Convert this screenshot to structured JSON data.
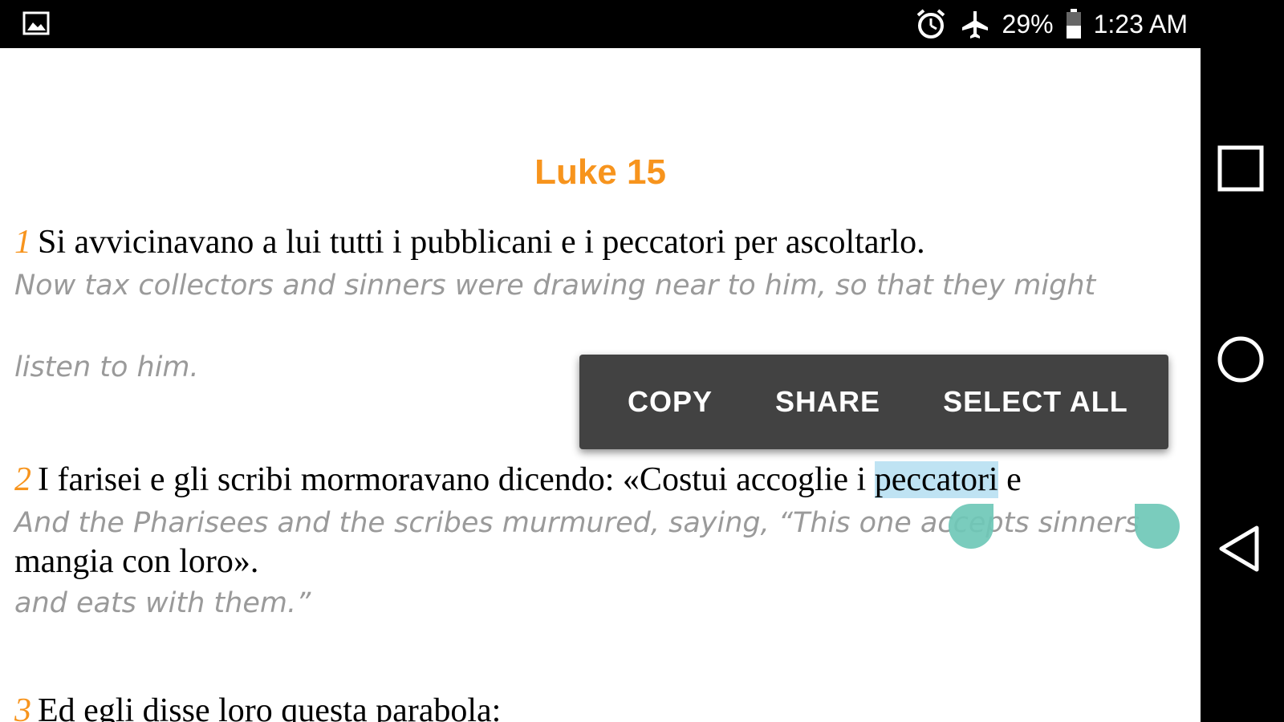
{
  "status_bar": {
    "left_icon": "image-icon",
    "icons": [
      "alarm-icon",
      "airplane-mode-icon",
      "battery-icon"
    ],
    "battery_percent": "29%",
    "time": "1:23 AM"
  },
  "chapter": {
    "title": "Luke 15"
  },
  "verses": [
    {
      "number": "1",
      "italian": "Si avvicinavano a lui tutti i pubblicani e i peccatori per ascoltarlo.",
      "english_line1": "Now tax collectors and sinners were drawing near to him, so that they might",
      "english_line2": "listen to him."
    },
    {
      "number": "2",
      "italian_before": "I farisei e gli scribi mormoravano dicendo: «Costui accoglie i ",
      "italian_selected": "peccatori",
      "italian_after": " e",
      "english_line1": "And the Pharisees and the scribes murmured, saying, “This one accepts sinners",
      "italian_line2": "mangia con loro».",
      "english_line2": "and eats with them.”"
    },
    {
      "number": "3",
      "italian": "Ed egli disse loro questa parabola:"
    }
  ],
  "context_menu": {
    "copy": "COPY",
    "share": "SHARE",
    "select_all": "SELECT ALL"
  },
  "nav_bar": {
    "buttons": [
      "recents-square-icon",
      "home-circle-icon",
      "back-triangle-icon"
    ]
  },
  "colors": {
    "accent": "#f7941d",
    "selection": "#bfe3f3",
    "handle": "#6fc8b7",
    "menu_bg": "#424242"
  }
}
